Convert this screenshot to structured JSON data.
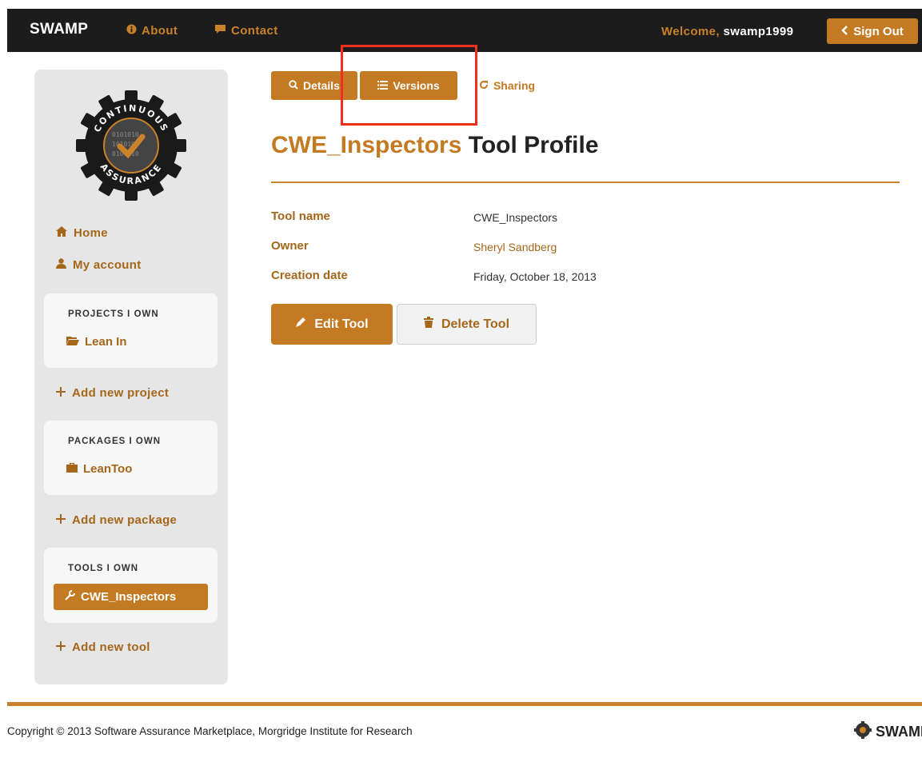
{
  "nav": {
    "brand": "SWAMP",
    "about": "About",
    "contact": "Contact",
    "welcome_label": "Welcome,",
    "username": "swamp1999",
    "signout": "Sign Out"
  },
  "logo": {
    "top_text": "CONTINUOUS",
    "bottom_text": "ASSURANCE"
  },
  "sidebar": {
    "home": "Home",
    "my_account": "My account",
    "projects_header": "PROJECTS I OWN",
    "projects": [
      "Lean In"
    ],
    "add_project": "Add new project",
    "packages_header": "PACKAGES I OWN",
    "packages": [
      "LeanToo"
    ],
    "add_package": "Add new package",
    "tools_header": "TOOLS I OWN",
    "tools": [
      "CWE_Inspectors"
    ],
    "add_tool": "Add new tool"
  },
  "tabs": {
    "details": "Details",
    "versions": "Versions",
    "sharing": "Sharing"
  },
  "page": {
    "title_name": "CWE_Inspectors",
    "title_rest": "Tool Profile"
  },
  "fields": [
    {
      "label": "Tool name",
      "value": "CWE_Inspectors"
    },
    {
      "label": "Owner",
      "value": "Sheryl Sandberg"
    },
    {
      "label": "Creation date",
      "value": "Friday, October 18, 2013"
    }
  ],
  "actions": {
    "edit": "Edit Tool",
    "delete": "Delete Tool"
  },
  "footer": {
    "copyright": "Copyright © 2013 Software Assurance Marketplace, Morgridge Institute for Research",
    "logo_text": "SWAMP"
  },
  "colors": {
    "accent": "#c47a22",
    "nav_bg": "#1c1c1c",
    "highlight": "#f0301f"
  }
}
